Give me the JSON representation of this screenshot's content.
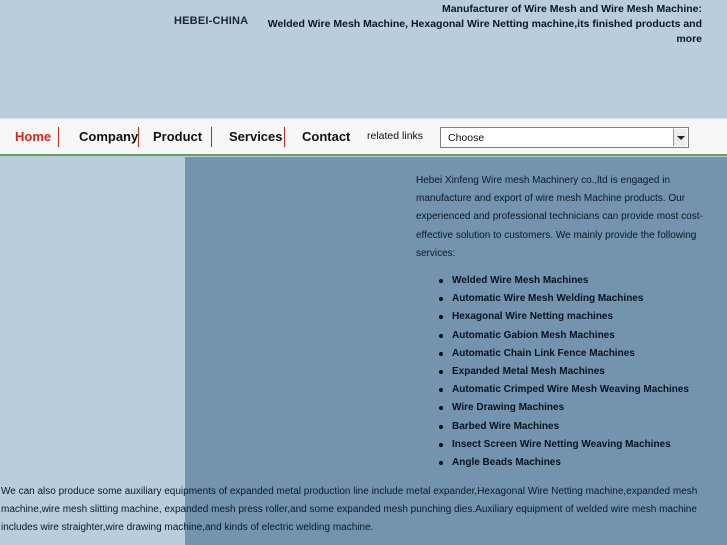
{
  "header": {
    "brand": "HEBEI-CHINA",
    "tagline_line1": "Manufacturer of Wire Mesh and Wire Mesh Machine:",
    "tagline_line2": "Welded Wire Mesh Machine, Hexagonal Wire Netting machine,its finished products and more"
  },
  "nav": {
    "items": [
      {
        "label": "Home"
      },
      {
        "label": "Company"
      },
      {
        "label": "Product"
      },
      {
        "label": "Services"
      },
      {
        "label": "Contact"
      }
    ],
    "related_label": "related links",
    "select_value": "Choose"
  },
  "content": {
    "intro": "  Hebei Xinfeng Wire mesh Machinery co.,ltd is engaged in manufacture and export of wire mesh Machine products. Our experienced and professional technicians can provide most cost-effective solution to customers. We mainly provide the following services:",
    "services": [
      "Welded Wire Mesh Machines",
      "Automatic Wire Mesh Welding Machines",
      "Hexagonal Wire Netting machines",
      "Automatic Gabion Mesh Machines",
      "Automatic Chain Link Fence Machines",
      "Expanded Metal Mesh Machines",
      "Automatic Crimped Wire Mesh Weaving Machines",
      "Wire Drawing Machines",
      "Barbed Wire Machines",
      "Insect Screen Wire Netting Weaving Machines",
      "Angle Beads Machines"
    ],
    "footer": "   We can also produce some auxiliary equipments of expanded metal production line include metal expander,Hexagonal Wire Netting   machine,expanded mesh machine,wire mesh slitting machine, expanded mesh press roller,and some expanded mesh punching   dies.Auxiliary equipment of welded wire mesh machine includes wire straighter,wire drawing machine,and kinds of electric welding   machine."
  },
  "colors": {
    "page_bg": "#b9cddd",
    "main_bg": "#7493af",
    "nav_active": "#e2231a",
    "nav_separator": "#d3241c",
    "nav_bottom_border": "#5fa35f"
  }
}
